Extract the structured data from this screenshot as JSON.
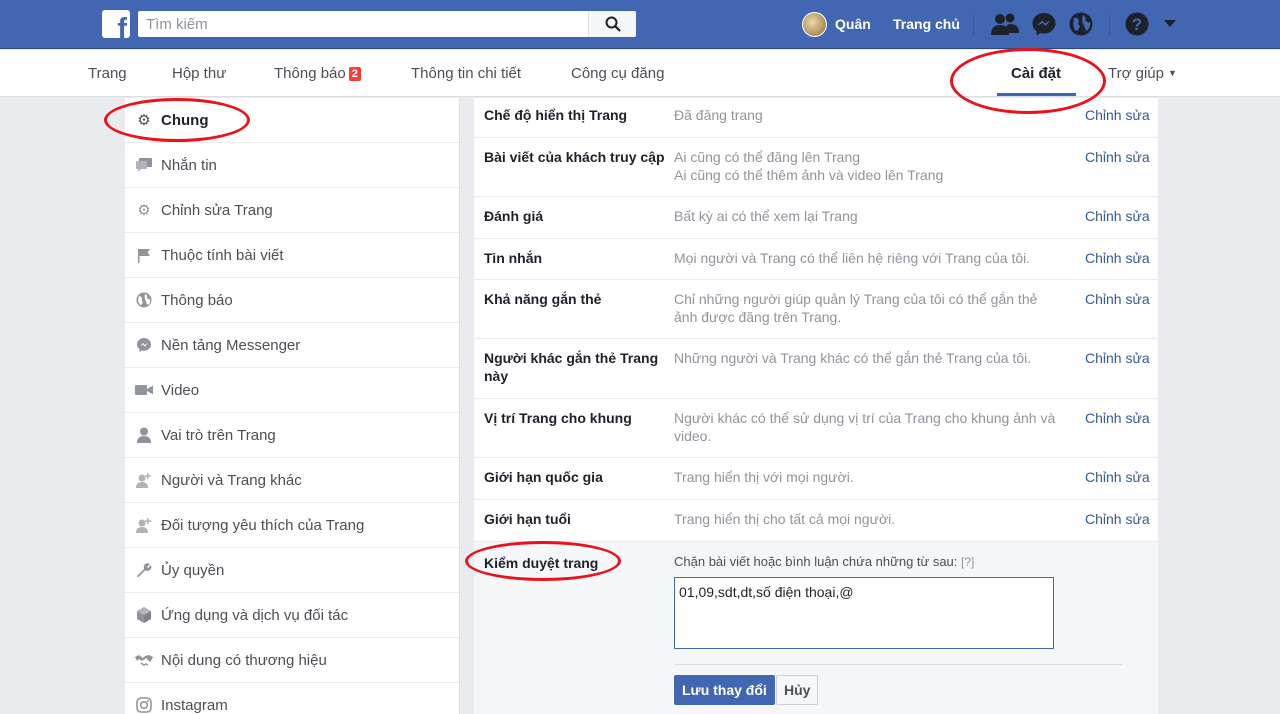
{
  "topbar": {
    "search_placeholder": "Tìm kiếm",
    "user_name": "Quân",
    "home_label": "Trang chủ"
  },
  "tabs": {
    "page": "Trang",
    "inbox": "Hộp thư",
    "notifications": "Thông báo",
    "notifications_badge": "2",
    "insights": "Thông tin chi tiết",
    "publishing_tools": "Công cụ đăng",
    "settings": "Cài đặt",
    "help": "Trợ giúp"
  },
  "sidebar": {
    "items": [
      {
        "label": "Chung",
        "icon": "gear-icon"
      },
      {
        "label": "Nhắn tin",
        "icon": "message-icon"
      },
      {
        "label": "Chỉnh sửa Trang",
        "icon": "gear-icon"
      },
      {
        "label": "Thuộc tính bài viết",
        "icon": "flag-icon"
      },
      {
        "label": "Thông báo",
        "icon": "globe-icon"
      },
      {
        "label": "Nền tảng Messenger",
        "icon": "messenger-icon"
      },
      {
        "label": "Video",
        "icon": "video-camera-icon"
      },
      {
        "label": "Vai trò trên Trang",
        "icon": "person-icon"
      },
      {
        "label": "Người và Trang khác",
        "icon": "person-add-icon"
      },
      {
        "label": "Đối tượng yêu thích của Trang",
        "icon": "person-add-icon"
      },
      {
        "label": "Ủy quyền",
        "icon": "wrench-icon"
      },
      {
        "label": "Ứng dụng và dịch vụ đối tác",
        "icon": "cube-icon"
      },
      {
        "label": "Nội dung có thương hiệu",
        "icon": "handshake-icon"
      },
      {
        "label": "Instagram",
        "icon": "instagram-icon"
      }
    ]
  },
  "settings": {
    "edit_label": "Chỉnh sửa",
    "rows": [
      {
        "label": "Chế độ hiển thị Trang",
        "value": "Đã đăng trang"
      },
      {
        "label": "Bài viết của khách truy cập",
        "value": "Ai cũng có thể đăng lên Trang",
        "value2": "Ai cũng có thể thêm ảnh và video lên Trang"
      },
      {
        "label": "Đánh giá",
        "value": "Bất kỳ ai có thể xem lại Trang"
      },
      {
        "label": "Tin nhắn",
        "value": "Mọi người và Trang có thể liên hệ riêng với Trang của tôi."
      },
      {
        "label": "Khả năng gắn thẻ",
        "value": "Chỉ những người giúp quản lý Trang của tôi có thể gắn thẻ ảnh được đăng trên Trang."
      },
      {
        "label": "Người khác gắn thẻ Trang này",
        "value": "Những người và Trang khác có thể gắn thẻ Trang của tôi."
      },
      {
        "label": "Vị trí Trang cho khung",
        "value": "Người khác có thể sử dụng vị trí của Trang cho khung ảnh và video."
      },
      {
        "label": "Giới hạn quốc gia",
        "value": "Trang hiển thị với mọi người."
      },
      {
        "label": "Giới hạn tuổi",
        "value": "Trang hiển thị cho tất cả mọi người."
      }
    ],
    "moderation": {
      "label": "Kiểm duyệt trang",
      "description": "Chặn bài viết hoặc bình luận chứa những từ sau:",
      "help": "[?]",
      "textarea_value": "01,09,sdt,dt,số điện thoại,@",
      "save_label": "Lưu thay đổi",
      "cancel_label": "Hủy"
    }
  },
  "colors": {
    "brand_blue": "#4267b2",
    "annotation_red": "#e8131c",
    "link_blue": "#365899"
  }
}
